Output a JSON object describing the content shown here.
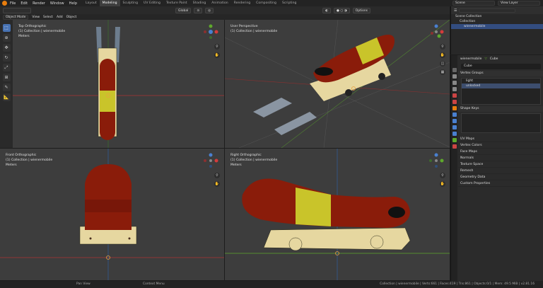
{
  "menu": {
    "items": [
      "File",
      "Edit",
      "Render",
      "Window",
      "Help"
    ]
  },
  "workspaces": {
    "tabs": [
      "Layout",
      "Modeling",
      "Sculpting",
      "UV Editing",
      "Texture Paint",
      "Shading",
      "Animation",
      "Rendering",
      "Compositing",
      "Scripting"
    ],
    "active": "Modeling"
  },
  "topright": {
    "scene": "Scene",
    "view_layer": "View Layer"
  },
  "viewheader": {
    "mode": "Object Mode",
    "view": "View",
    "select": "Select",
    "add": "Add",
    "object": "Object",
    "transform": "Global",
    "options": "Options"
  },
  "viewports": {
    "top": {
      "title": "Top Orthographic",
      "collection": "(1) Collection | wienermobile",
      "units": "Meters"
    },
    "user": {
      "title": "User Perspective",
      "collection": "(1) Collection | wienermobile"
    },
    "front": {
      "title": "Front Orthographic",
      "collection": "(1) Collection | wienermobile",
      "units": "Meters"
    },
    "right": {
      "title": "Right Orthographic",
      "collection": "(1) Collection | wienermobile",
      "units": "Meters"
    }
  },
  "outliner": {
    "root": "Scene Collection",
    "collection": "Collection",
    "object": "wienermobile"
  },
  "properties": {
    "object": "wienermobile",
    "mesh": "Cube",
    "data": "Cube",
    "vertex_groups_title": "Vertex Groups",
    "vertex_groups": [
      "light",
      "unlocked"
    ],
    "shape_keys_title": "Shape Keys",
    "closed_panels": [
      "UV Maps",
      "Vertex Colors",
      "Face Maps",
      "Normals",
      "Texture Space",
      "Remesh",
      "Geometry Data",
      "Custom Properties"
    ]
  },
  "status": {
    "left": "Pan View",
    "mid": "Context Menu",
    "right": "Collection | wienermobile | Verts:661 | Faces:419 | Tris:861 | Objects:0/1 | Mem: 49.5 MiB | v2.81.16"
  },
  "colors": {
    "accent": "#4772b3",
    "wiener": "#8a1c0a",
    "mustard": "#c9c42a",
    "bun": "#e6d7a0",
    "xaxis": "#d43b3b",
    "yaxis": "#5ea82c"
  }
}
